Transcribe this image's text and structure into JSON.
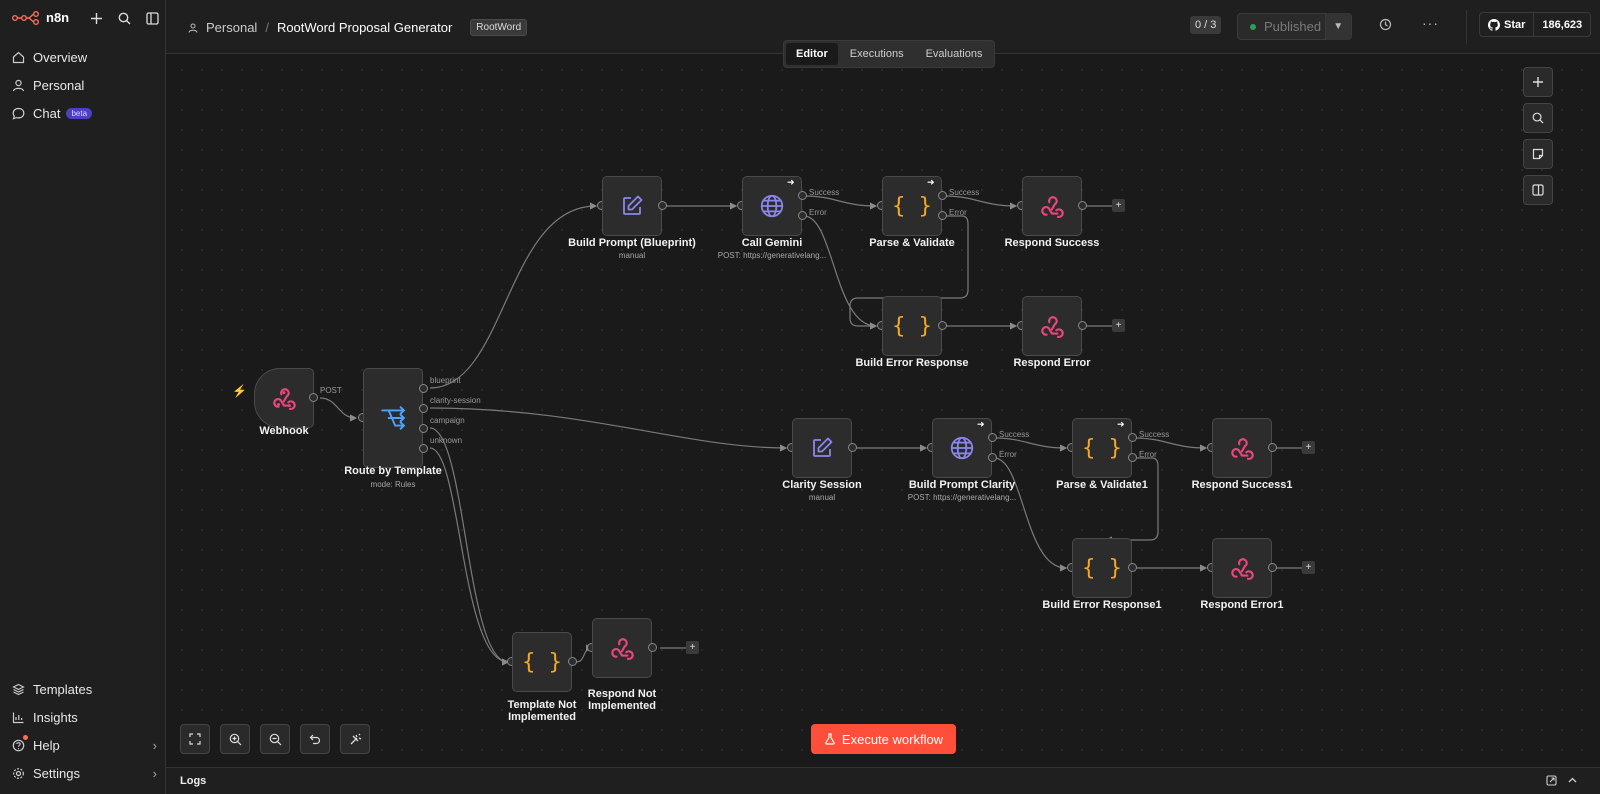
{
  "app": {
    "logo_text": "n8n"
  },
  "sidebar": {
    "items": [
      {
        "label": "Overview"
      },
      {
        "label": "Personal"
      },
      {
        "label": "Chat",
        "badge": "beta"
      }
    ],
    "bottom_items": [
      {
        "label": "Templates"
      },
      {
        "label": "Insights"
      },
      {
        "label": "Help"
      },
      {
        "label": "Settings"
      }
    ]
  },
  "header": {
    "breadcrumb_project": "Personal",
    "workflow_name": "RootWord Proposal Generator",
    "tag": "RootWord",
    "counter": "0 / 3",
    "publish_label": "Published",
    "github_star_label": "Star",
    "github_star_count": "186,623"
  },
  "tabs": [
    {
      "label": "Editor",
      "active": true
    },
    {
      "label": "Executions"
    },
    {
      "label": "Evaluations"
    }
  ],
  "nodes": {
    "webhook": {
      "label": "Webhook",
      "port": "POST"
    },
    "route": {
      "label": "Route by Template",
      "sub": "mode: Rules",
      "ports": [
        "blueprint",
        "clarity-session",
        "campaign",
        "unknown"
      ]
    },
    "build_prompt": {
      "label": "Build Prompt (Blueprint)",
      "sub": "manual"
    },
    "call_gemini": {
      "label": "Call Gemini",
      "sub": "POST: https://generativelang..."
    },
    "parse_validate": {
      "label": "Parse & Validate"
    },
    "respond_success": {
      "label": "Respond Success"
    },
    "build_error": {
      "label": "Build Error Response"
    },
    "respond_error": {
      "label": "Respond Error"
    },
    "clarity_session": {
      "label": "Clarity Session",
      "sub": "manual"
    },
    "build_prompt_clarity": {
      "label": "Build Prompt Clarity",
      "sub": "POST: https://generativelang..."
    },
    "parse_validate1": {
      "label": "Parse & Validate1"
    },
    "respond_success1": {
      "label": "Respond Success1"
    },
    "build_error1": {
      "label": "Build Error Response1"
    },
    "respond_error1": {
      "label": "Respond Error1"
    },
    "template_not_impl": {
      "label": "Template Not Implemented"
    },
    "respond_not_impl": {
      "label": "Respond Not Implemented"
    }
  },
  "port_labels": {
    "success": "Success",
    "error": "Error"
  },
  "execute_button": "Execute workflow",
  "logs_label": "Logs",
  "colors": {
    "accent": "#ff4f3a",
    "webhook": "#e8467c",
    "code": "#f5a623",
    "http": "#8b86f0",
    "edit": "#8b86f0",
    "switch": "#4aa3ff"
  }
}
